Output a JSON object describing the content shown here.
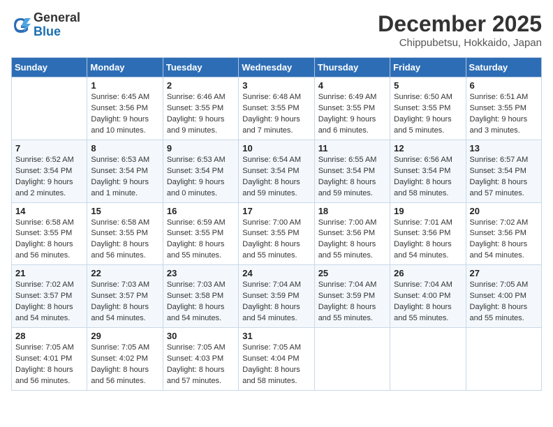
{
  "header": {
    "logo_general": "General",
    "logo_blue": "Blue",
    "month_title": "December 2025",
    "location": "Chippubetsu, Hokkaido, Japan"
  },
  "weekdays": [
    "Sunday",
    "Monday",
    "Tuesday",
    "Wednesday",
    "Thursday",
    "Friday",
    "Saturday"
  ],
  "weeks": [
    [
      {
        "day": "",
        "info": ""
      },
      {
        "day": "1",
        "info": "Sunrise: 6:45 AM\nSunset: 3:56 PM\nDaylight: 9 hours\nand 10 minutes."
      },
      {
        "day": "2",
        "info": "Sunrise: 6:46 AM\nSunset: 3:55 PM\nDaylight: 9 hours\nand 9 minutes."
      },
      {
        "day": "3",
        "info": "Sunrise: 6:48 AM\nSunset: 3:55 PM\nDaylight: 9 hours\nand 7 minutes."
      },
      {
        "day": "4",
        "info": "Sunrise: 6:49 AM\nSunset: 3:55 PM\nDaylight: 9 hours\nand 6 minutes."
      },
      {
        "day": "5",
        "info": "Sunrise: 6:50 AM\nSunset: 3:55 PM\nDaylight: 9 hours\nand 5 minutes."
      },
      {
        "day": "6",
        "info": "Sunrise: 6:51 AM\nSunset: 3:55 PM\nDaylight: 9 hours\nand 3 minutes."
      }
    ],
    [
      {
        "day": "7",
        "info": "Sunrise: 6:52 AM\nSunset: 3:54 PM\nDaylight: 9 hours\nand 2 minutes."
      },
      {
        "day": "8",
        "info": "Sunrise: 6:53 AM\nSunset: 3:54 PM\nDaylight: 9 hours\nand 1 minute."
      },
      {
        "day": "9",
        "info": "Sunrise: 6:53 AM\nSunset: 3:54 PM\nDaylight: 9 hours\nand 0 minutes."
      },
      {
        "day": "10",
        "info": "Sunrise: 6:54 AM\nSunset: 3:54 PM\nDaylight: 8 hours\nand 59 minutes."
      },
      {
        "day": "11",
        "info": "Sunrise: 6:55 AM\nSunset: 3:54 PM\nDaylight: 8 hours\nand 59 minutes."
      },
      {
        "day": "12",
        "info": "Sunrise: 6:56 AM\nSunset: 3:54 PM\nDaylight: 8 hours\nand 58 minutes."
      },
      {
        "day": "13",
        "info": "Sunrise: 6:57 AM\nSunset: 3:54 PM\nDaylight: 8 hours\nand 57 minutes."
      }
    ],
    [
      {
        "day": "14",
        "info": "Sunrise: 6:58 AM\nSunset: 3:55 PM\nDaylight: 8 hours\nand 56 minutes."
      },
      {
        "day": "15",
        "info": "Sunrise: 6:58 AM\nSunset: 3:55 PM\nDaylight: 8 hours\nand 56 minutes."
      },
      {
        "day": "16",
        "info": "Sunrise: 6:59 AM\nSunset: 3:55 PM\nDaylight: 8 hours\nand 55 minutes."
      },
      {
        "day": "17",
        "info": "Sunrise: 7:00 AM\nSunset: 3:55 PM\nDaylight: 8 hours\nand 55 minutes."
      },
      {
        "day": "18",
        "info": "Sunrise: 7:00 AM\nSunset: 3:56 PM\nDaylight: 8 hours\nand 55 minutes."
      },
      {
        "day": "19",
        "info": "Sunrise: 7:01 AM\nSunset: 3:56 PM\nDaylight: 8 hours\nand 54 minutes."
      },
      {
        "day": "20",
        "info": "Sunrise: 7:02 AM\nSunset: 3:56 PM\nDaylight: 8 hours\nand 54 minutes."
      }
    ],
    [
      {
        "day": "21",
        "info": "Sunrise: 7:02 AM\nSunset: 3:57 PM\nDaylight: 8 hours\nand 54 minutes."
      },
      {
        "day": "22",
        "info": "Sunrise: 7:03 AM\nSunset: 3:57 PM\nDaylight: 8 hours\nand 54 minutes."
      },
      {
        "day": "23",
        "info": "Sunrise: 7:03 AM\nSunset: 3:58 PM\nDaylight: 8 hours\nand 54 minutes."
      },
      {
        "day": "24",
        "info": "Sunrise: 7:04 AM\nSunset: 3:59 PM\nDaylight: 8 hours\nand 54 minutes."
      },
      {
        "day": "25",
        "info": "Sunrise: 7:04 AM\nSunset: 3:59 PM\nDaylight: 8 hours\nand 55 minutes."
      },
      {
        "day": "26",
        "info": "Sunrise: 7:04 AM\nSunset: 4:00 PM\nDaylight: 8 hours\nand 55 minutes."
      },
      {
        "day": "27",
        "info": "Sunrise: 7:05 AM\nSunset: 4:00 PM\nDaylight: 8 hours\nand 55 minutes."
      }
    ],
    [
      {
        "day": "28",
        "info": "Sunrise: 7:05 AM\nSunset: 4:01 PM\nDaylight: 8 hours\nand 56 minutes."
      },
      {
        "day": "29",
        "info": "Sunrise: 7:05 AM\nSunset: 4:02 PM\nDaylight: 8 hours\nand 56 minutes."
      },
      {
        "day": "30",
        "info": "Sunrise: 7:05 AM\nSunset: 4:03 PM\nDaylight: 8 hours\nand 57 minutes."
      },
      {
        "day": "31",
        "info": "Sunrise: 7:05 AM\nSunset: 4:04 PM\nDaylight: 8 hours\nand 58 minutes."
      },
      {
        "day": "",
        "info": ""
      },
      {
        "day": "",
        "info": ""
      },
      {
        "day": "",
        "info": ""
      }
    ]
  ]
}
